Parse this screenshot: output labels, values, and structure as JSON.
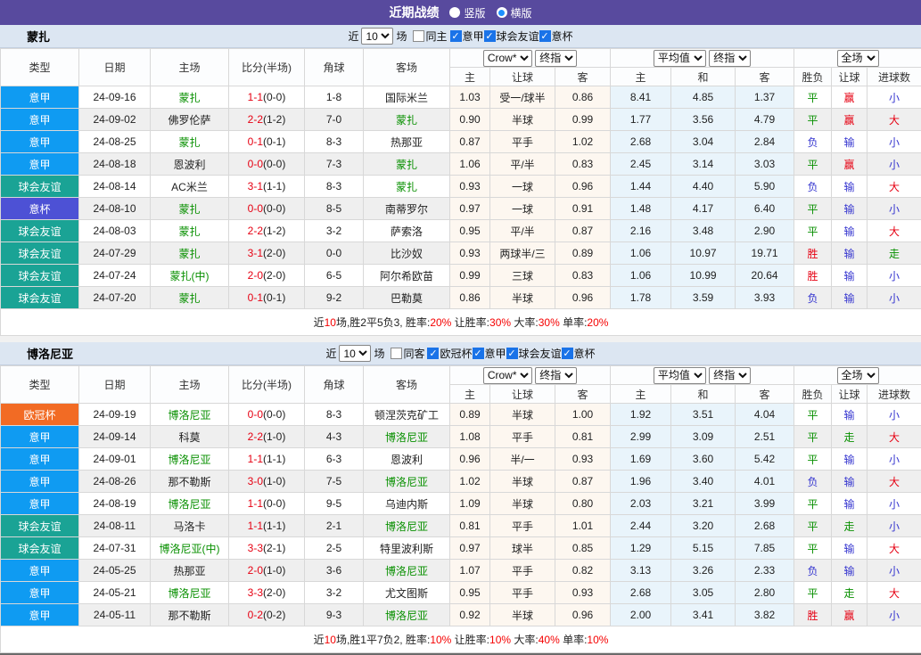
{
  "header": {
    "title": "近期战绩",
    "radio_vertical": "竖版",
    "radio_horizontal": "横版"
  },
  "filter_labels": {
    "near": "近",
    "games": "场"
  },
  "table_header": {
    "type": "类型",
    "date": "日期",
    "home": "主场",
    "score": "比分(半场)",
    "corner": "角球",
    "away": "客场",
    "crow_select": "Crow*",
    "final_select": "终指",
    "avg_select": "平均值",
    "full_select": "全场",
    "h": "主",
    "handicap": "让球",
    "a": "客",
    "draw": "和",
    "wl": "胜负",
    "goals": "进球数"
  },
  "league_colors": {
    "意甲": "#0f9bf2",
    "球会友谊": "#1aa395",
    "意杯": "#4d51d5",
    "欧冠杯": "#f26b24"
  },
  "sections": [
    {
      "team": "蒙扎",
      "filter": {
        "count": "10",
        "same_label": "同主",
        "leagues": [
          "意甲",
          "球会友谊",
          "意杯"
        ]
      },
      "rows": [
        {
          "league": "意甲",
          "date": "24-09-16",
          "home": "蒙扎",
          "hg": true,
          "score": "1-1",
          "half": "(0-0)",
          "corner": "1-8",
          "away": "国际米兰",
          "ag": false,
          "crow": [
            "1.03",
            "受一/球半",
            "0.86"
          ],
          "avg": [
            "8.41",
            "4.85",
            "1.37"
          ],
          "wl": "平",
          "wlc": "g",
          "hc": "赢",
          "hcc": "r",
          "go": "小",
          "goc": "b"
        },
        {
          "league": "意甲",
          "date": "24-09-02",
          "home": "佛罗伦萨",
          "hg": false,
          "score": "2-2",
          "half": "(1-2)",
          "corner": "7-0",
          "away": "蒙扎",
          "ag": true,
          "crow": [
            "0.90",
            "半球",
            "0.99"
          ],
          "avg": [
            "1.77",
            "3.56",
            "4.79"
          ],
          "wl": "平",
          "wlc": "g",
          "hc": "赢",
          "hcc": "r",
          "go": "大",
          "goc": "r"
        },
        {
          "league": "意甲",
          "date": "24-08-25",
          "home": "蒙扎",
          "hg": true,
          "score": "0-1",
          "half": "(0-1)",
          "corner": "8-3",
          "away": "热那亚",
          "ag": false,
          "crow": [
            "0.87",
            "平手",
            "1.02"
          ],
          "avg": [
            "2.68",
            "3.04",
            "2.84"
          ],
          "wl": "负",
          "wlc": "b",
          "hc": "输",
          "hcc": "b",
          "go": "小",
          "goc": "b"
        },
        {
          "league": "意甲",
          "date": "24-08-18",
          "home": "恩波利",
          "hg": false,
          "score": "0-0",
          "half": "(0-0)",
          "corner": "7-3",
          "away": "蒙扎",
          "ag": true,
          "crow": [
            "1.06",
            "平/半",
            "0.83"
          ],
          "avg": [
            "2.45",
            "3.14",
            "3.03"
          ],
          "wl": "平",
          "wlc": "g",
          "hc": "赢",
          "hcc": "r",
          "go": "小",
          "goc": "b"
        },
        {
          "league": "球会友谊",
          "date": "24-08-14",
          "home": "AC米兰",
          "hg": false,
          "score": "3-1",
          "half": "(1-1)",
          "corner": "8-3",
          "away": "蒙扎",
          "ag": true,
          "crow": [
            "0.93",
            "一球",
            "0.96"
          ],
          "avg": [
            "1.44",
            "4.40",
            "5.90"
          ],
          "wl": "负",
          "wlc": "b",
          "hc": "输",
          "hcc": "b",
          "go": "大",
          "goc": "r"
        },
        {
          "league": "意杯",
          "date": "24-08-10",
          "home": "蒙扎",
          "hg": true,
          "score": "0-0",
          "half": "(0-0)",
          "corner": "8-5",
          "away": "南蒂罗尔",
          "ag": false,
          "crow": [
            "0.97",
            "一球",
            "0.91"
          ],
          "avg": [
            "1.48",
            "4.17",
            "6.40"
          ],
          "wl": "平",
          "wlc": "g",
          "hc": "输",
          "hcc": "b",
          "go": "小",
          "goc": "b"
        },
        {
          "league": "球会友谊",
          "date": "24-08-03",
          "home": "蒙扎",
          "hg": true,
          "score": "2-2",
          "half": "(1-2)",
          "corner": "3-2",
          "away": "萨索洛",
          "ag": false,
          "crow": [
            "0.95",
            "平/半",
            "0.87"
          ],
          "avg": [
            "2.16",
            "3.48",
            "2.90"
          ],
          "wl": "平",
          "wlc": "g",
          "hc": "输",
          "hcc": "b",
          "go": "大",
          "goc": "r"
        },
        {
          "league": "球会友谊",
          "date": "24-07-29",
          "home": "蒙扎",
          "hg": true,
          "score": "3-1",
          "half": "(2-0)",
          "corner": "0-0",
          "away": "比沙奴",
          "ag": false,
          "crow": [
            "0.93",
            "两球半/三",
            "0.89"
          ],
          "avg": [
            "1.06",
            "10.97",
            "19.71"
          ],
          "wl": "胜",
          "wlc": "r",
          "hc": "输",
          "hcc": "b",
          "go": "走",
          "goc": "g"
        },
        {
          "league": "球会友谊",
          "date": "24-07-24",
          "home": "蒙扎(中)",
          "hg": true,
          "score": "2-0",
          "half": "(2-0)",
          "corner": "6-5",
          "away": "阿尔希欧苗",
          "ag": false,
          "crow": [
            "0.99",
            "三球",
            "0.83"
          ],
          "avg": [
            "1.06",
            "10.99",
            "20.64"
          ],
          "wl": "胜",
          "wlc": "r",
          "hc": "输",
          "hcc": "b",
          "go": "小",
          "goc": "b"
        },
        {
          "league": "球会友谊",
          "date": "24-07-20",
          "home": "蒙扎",
          "hg": true,
          "score": "0-1",
          "half": "(0-1)",
          "corner": "9-2",
          "away": "巴勒莫",
          "ag": false,
          "crow": [
            "0.86",
            "半球",
            "0.96"
          ],
          "avg": [
            "1.78",
            "3.59",
            "3.93"
          ],
          "wl": "负",
          "wlc": "b",
          "hc": "输",
          "hcc": "b",
          "go": "小",
          "goc": "b"
        }
      ],
      "summary": [
        {
          "t": "近",
          "red": false
        },
        {
          "t": "10",
          "red": true
        },
        {
          "t": "场,胜2平5负3, 胜率:",
          "red": false
        },
        {
          "t": "20%",
          "red": true
        },
        {
          "t": " 让胜率:",
          "red": false
        },
        {
          "t": "30%",
          "red": true
        },
        {
          "t": " 大率:",
          "red": false
        },
        {
          "t": "30%",
          "red": true
        },
        {
          "t": " 单率:",
          "red": false
        },
        {
          "t": "20%",
          "red": true
        }
      ]
    },
    {
      "team": "博洛尼亚",
      "filter": {
        "count": "10",
        "same_label": "同客",
        "leagues": [
          "欧冠杯",
          "意甲",
          "球会友谊",
          "意杯"
        ]
      },
      "rows": [
        {
          "league": "欧冠杯",
          "date": "24-09-19",
          "home": "博洛尼亚",
          "hg": true,
          "score": "0-0",
          "half": "(0-0)",
          "corner": "8-3",
          "away": "顿涅茨克矿工",
          "ag": false,
          "crow": [
            "0.89",
            "半球",
            "1.00"
          ],
          "avg": [
            "1.92",
            "3.51",
            "4.04"
          ],
          "wl": "平",
          "wlc": "g",
          "hc": "输",
          "hcc": "b",
          "go": "小",
          "goc": "b"
        },
        {
          "league": "意甲",
          "date": "24-09-14",
          "home": "科莫",
          "hg": false,
          "score": "2-2",
          "half": "(1-0)",
          "corner": "4-3",
          "away": "博洛尼亚",
          "ag": true,
          "crow": [
            "1.08",
            "平手",
            "0.81"
          ],
          "avg": [
            "2.99",
            "3.09",
            "2.51"
          ],
          "wl": "平",
          "wlc": "g",
          "hc": "走",
          "hcc": "g",
          "go": "大",
          "goc": "r"
        },
        {
          "league": "意甲",
          "date": "24-09-01",
          "home": "博洛尼亚",
          "hg": true,
          "score": "1-1",
          "half": "(1-1)",
          "corner": "6-3",
          "away": "恩波利",
          "ag": false,
          "crow": [
            "0.96",
            "半/一",
            "0.93"
          ],
          "avg": [
            "1.69",
            "3.60",
            "5.42"
          ],
          "wl": "平",
          "wlc": "g",
          "hc": "输",
          "hcc": "b",
          "go": "小",
          "goc": "b"
        },
        {
          "league": "意甲",
          "date": "24-08-26",
          "home": "那不勒斯",
          "hg": false,
          "score": "3-0",
          "half": "(1-0)",
          "corner": "7-5",
          "away": "博洛尼亚",
          "ag": true,
          "crow": [
            "1.02",
            "半球",
            "0.87"
          ],
          "avg": [
            "1.96",
            "3.40",
            "4.01"
          ],
          "wl": "负",
          "wlc": "b",
          "hc": "输",
          "hcc": "b",
          "go": "大",
          "goc": "r"
        },
        {
          "league": "意甲",
          "date": "24-08-19",
          "home": "博洛尼亚",
          "hg": true,
          "score": "1-1",
          "half": "(0-0)",
          "corner": "9-5",
          "away": "乌迪内斯",
          "ag": false,
          "crow": [
            "1.09",
            "半球",
            "0.80"
          ],
          "avg": [
            "2.03",
            "3.21",
            "3.99"
          ],
          "wl": "平",
          "wlc": "g",
          "hc": "输",
          "hcc": "b",
          "go": "小",
          "goc": "b"
        },
        {
          "league": "球会友谊",
          "date": "24-08-11",
          "home": "马洛卡",
          "hg": false,
          "score": "1-1",
          "half": "(1-1)",
          "corner": "2-1",
          "away": "博洛尼亚",
          "ag": true,
          "crow": [
            "0.81",
            "平手",
            "1.01"
          ],
          "avg": [
            "2.44",
            "3.20",
            "2.68"
          ],
          "wl": "平",
          "wlc": "g",
          "hc": "走",
          "hcc": "g",
          "go": "小",
          "goc": "b"
        },
        {
          "league": "球会友谊",
          "date": "24-07-31",
          "home": "博洛尼亚(中)",
          "hg": true,
          "score": "3-3",
          "half": "(2-1)",
          "corner": "2-5",
          "away": "特里波利斯",
          "ag": false,
          "crow": [
            "0.97",
            "球半",
            "0.85"
          ],
          "avg": [
            "1.29",
            "5.15",
            "7.85"
          ],
          "wl": "平",
          "wlc": "g",
          "hc": "输",
          "hcc": "b",
          "go": "大",
          "goc": "r"
        },
        {
          "league": "意甲",
          "date": "24-05-25",
          "home": "热那亚",
          "hg": false,
          "score": "2-0",
          "half": "(1-0)",
          "corner": "3-6",
          "away": "博洛尼亚",
          "ag": true,
          "crow": [
            "1.07",
            "平手",
            "0.82"
          ],
          "avg": [
            "3.13",
            "3.26",
            "2.33"
          ],
          "wl": "负",
          "wlc": "b",
          "hc": "输",
          "hcc": "b",
          "go": "小",
          "goc": "b"
        },
        {
          "league": "意甲",
          "date": "24-05-21",
          "home": "博洛尼亚",
          "hg": true,
          "score": "3-3",
          "half": "(2-0)",
          "corner": "3-2",
          "away": "尤文图斯",
          "ag": false,
          "crow": [
            "0.95",
            "平手",
            "0.93"
          ],
          "avg": [
            "2.68",
            "3.05",
            "2.80"
          ],
          "wl": "平",
          "wlc": "g",
          "hc": "走",
          "hcc": "g",
          "go": "大",
          "goc": "r"
        },
        {
          "league": "意甲",
          "date": "24-05-11",
          "home": "那不勒斯",
          "hg": false,
          "score": "0-2",
          "half": "(0-2)",
          "corner": "9-3",
          "away": "博洛尼亚",
          "ag": true,
          "crow": [
            "0.92",
            "半球",
            "0.96"
          ],
          "avg": [
            "2.00",
            "3.41",
            "3.82"
          ],
          "wl": "胜",
          "wlc": "r",
          "hc": "赢",
          "hcc": "r",
          "go": "小",
          "goc": "b"
        }
      ],
      "summary": [
        {
          "t": "近",
          "red": false
        },
        {
          "t": "10",
          "red": true
        },
        {
          "t": "场,胜1平7负2, 胜率:",
          "red": false
        },
        {
          "t": "10%",
          "red": true
        },
        {
          "t": " 让胜率:",
          "red": false
        },
        {
          "t": "10%",
          "red": true
        },
        {
          "t": " 大率:",
          "red": false
        },
        {
          "t": "40%",
          "red": true
        },
        {
          "t": " 单率:",
          "red": false
        },
        {
          "t": "10%",
          "red": true
        }
      ]
    }
  ]
}
